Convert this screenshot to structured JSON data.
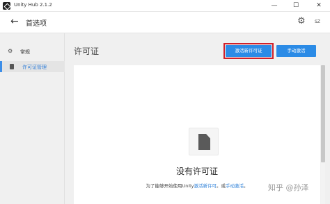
{
  "window": {
    "title": "Unity Hub 2.1.2",
    "minimize": "—",
    "maximize": "☐",
    "close": "✕"
  },
  "header": {
    "back_glyph": "←",
    "title": "首选项",
    "gear_glyph": "⚙",
    "user_initials": "SZ"
  },
  "sidebar": {
    "items": [
      {
        "label": "常规",
        "icon": "gear-icon",
        "glyph": "⚙"
      },
      {
        "label": "许可证管理",
        "icon": "document-icon"
      }
    ]
  },
  "main": {
    "section_title": "许可证",
    "activate_button": "激活新许可证",
    "manual_button": "手动激活",
    "empty_title": "没有许可证",
    "hint_prefix": "为了能够开始使用Unity",
    "hint_link1": "激活新许可",
    "hint_mid": "。或",
    "hint_link2": "手动激活",
    "hint_suffix": "。"
  },
  "watermark": "知乎 @孙泽",
  "colors": {
    "accent": "#2b8be6",
    "highlight_border": "#d0202a"
  }
}
